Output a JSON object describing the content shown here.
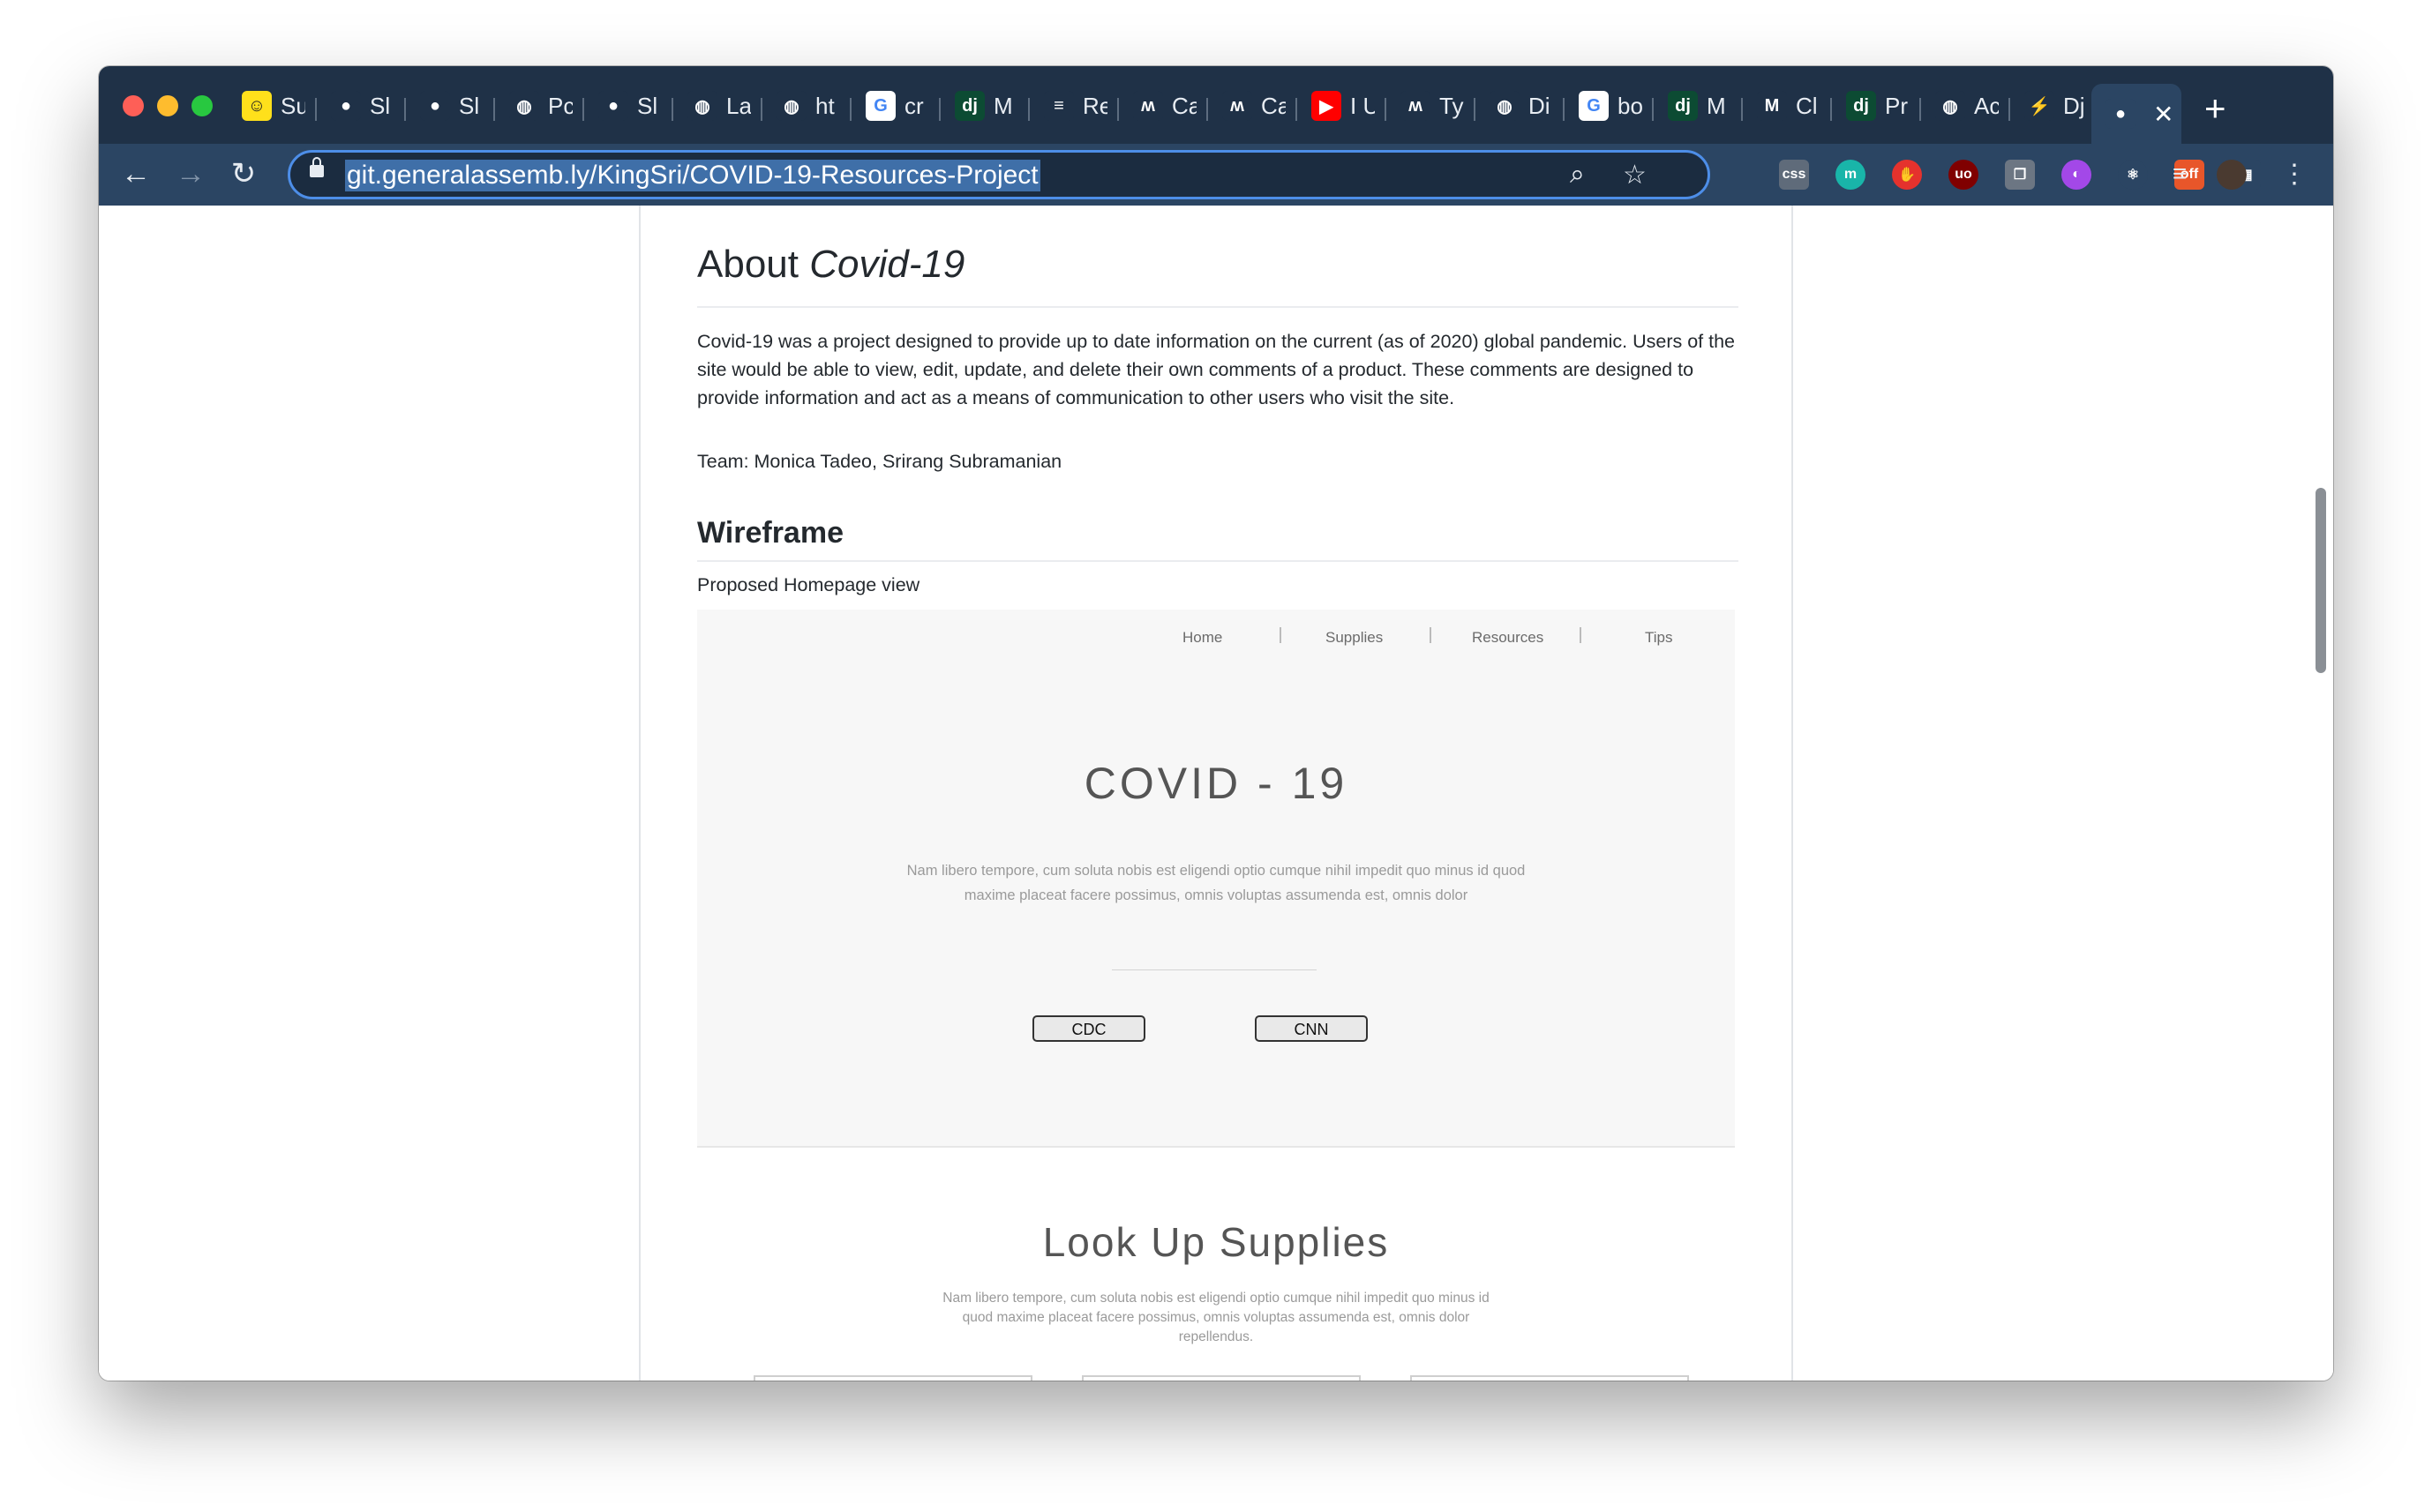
{
  "browser": {
    "tabs": [
      {
        "title": "Su",
        "icon": "mailchimp-icon",
        "color": "#ffe01b",
        "glyph": "☺"
      },
      {
        "title": "Sl",
        "icon": "github-icon",
        "color": "#1f3147",
        "glyph": "●"
      },
      {
        "title": "Sl",
        "icon": "github-icon",
        "color": "#1f3147",
        "glyph": "●"
      },
      {
        "title": "Pc",
        "icon": "globe-icon",
        "color": "#1f3147",
        "glyph": "◍"
      },
      {
        "title": "Sl",
        "icon": "github-icon",
        "color": "#1f3147",
        "glyph": "●"
      },
      {
        "title": "La",
        "icon": "globe-icon",
        "color": "#1f3147",
        "glyph": "◍"
      },
      {
        "title": "ht",
        "icon": "globe-icon",
        "color": "#1f3147",
        "glyph": "◍"
      },
      {
        "title": "cr",
        "icon": "google-icon",
        "color": "#ffffff",
        "glyph": "G"
      },
      {
        "title": "M",
        "icon": "django-icon",
        "color": "#0c4b33",
        "glyph": "dj"
      },
      {
        "title": "Re",
        "icon": "stackoverflow-icon",
        "color": "#1f3147",
        "glyph": "≡"
      },
      {
        "title": "Ca",
        "icon": "miro-icon",
        "color": "#1f3147",
        "glyph": "ʍ"
      },
      {
        "title": "Ca",
        "icon": "miro-icon",
        "color": "#1f3147",
        "glyph": "ʍ"
      },
      {
        "title": "I U",
        "icon": "youtube-icon",
        "color": "#ff0000",
        "glyph": "▶"
      },
      {
        "title": "Ty",
        "icon": "miro-icon",
        "color": "#1f3147",
        "glyph": "ʍ"
      },
      {
        "title": "Di",
        "icon": "globe-icon",
        "color": "#1f3147",
        "glyph": "◍"
      },
      {
        "title": "bo",
        "icon": "google-icon",
        "color": "#ffffff",
        "glyph": "G"
      },
      {
        "title": "M",
        "icon": "django-icon",
        "color": "#0c4b33",
        "glyph": "dj"
      },
      {
        "title": "Cl",
        "icon": "gmail-icon",
        "color": "#1f3147",
        "glyph": "M"
      },
      {
        "title": "Pr",
        "icon": "django-icon",
        "color": "#0c4b33",
        "glyph": "dj"
      },
      {
        "title": "Ac",
        "icon": "globe-icon",
        "color": "#1f3147",
        "glyph": "◍"
      },
      {
        "title": "Dj",
        "icon": "vite-icon",
        "color": "#1f3147",
        "glyph": "⚡"
      }
    ],
    "active_tab": {
      "title": "",
      "icon": "github-icon",
      "close": "✕"
    },
    "new_tab": "+",
    "url": "git.generalassemb.ly/KingSri/COVID-19-Resources-Project",
    "extensions": [
      {
        "name": "css-viewer-extension-icon",
        "label": "css",
        "color": "#5f6b7a"
      },
      {
        "name": "mint-extension-icon",
        "label": "m",
        "color": "#19b5a9"
      },
      {
        "name": "hand-extension-icon",
        "label": "✋",
        "color": "#e5322d"
      },
      {
        "name": "ublock-extension-icon",
        "label": "uo",
        "color": "#800000"
      },
      {
        "name": "copy-extension-icon",
        "label": "❐",
        "color": "#6c7683"
      },
      {
        "name": "purple-extension-icon",
        "label": "◐",
        "color": "#a348e8"
      },
      {
        "name": "react-devtools-icon",
        "label": "⚛",
        "color": "#2b4563"
      },
      {
        "name": "pdf-off-extension-icon",
        "label": "off",
        "color": "#e8562a"
      },
      {
        "name": "grid-extension-icon",
        "label": "▦",
        "color": "#2b4563"
      }
    ]
  },
  "readme": {
    "title_plain": "About ",
    "title_em": "Covid-19",
    "description": "Covid-19 was a project designed to provide up to date information on the current (as of 2020) global pandemic. Users of the site would be able to view, edit, update, and delete their own comments of a product. These comments are designed to provide information and act as a means of communication to other users who visit the site.",
    "team": "Team: Monica Tadeo, Srirang Subramanian",
    "wireframe_heading": "Wireframe",
    "proposed_caption": "Proposed Homepage view"
  },
  "wireframe": {
    "nav": [
      "Home",
      "Supplies",
      "Resources",
      "Tips"
    ],
    "hero_title": "COVID - 19",
    "hero_text": "Nam libero tempore, cum soluta nobis est eligendi optio cumque nihil impedit quo minus id quod maxime placeat facere possimus, omnis voluptas assumenda est, omnis dolor",
    "buttons": [
      "CDC",
      "CNN"
    ],
    "section_title": "Look Up Supplies",
    "section_text": "Nam libero tempore, cum soluta nobis est eligendi optio cumque nihil impedit quo minus id quod maxime placeat facere possimus, omnis voluptas assumenda est, omnis dolor repellendus."
  }
}
